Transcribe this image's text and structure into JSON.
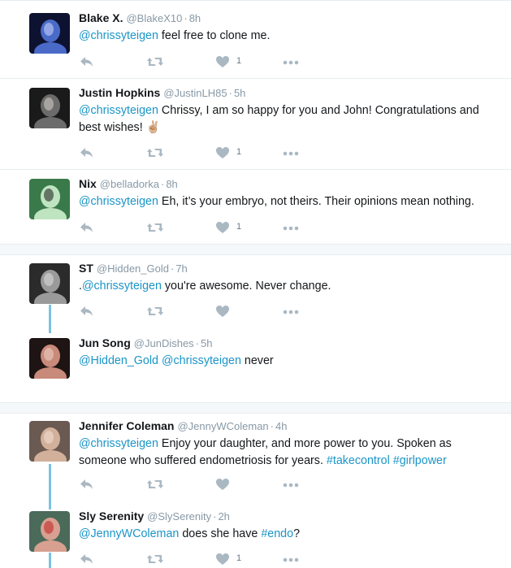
{
  "tweets": [
    {
      "name": "Blake X.",
      "handle": "@BlakeX10",
      "time": "8h",
      "segments": [
        {
          "t": "@chrissyteigen",
          "k": "m"
        },
        {
          "t": " feel free to clone me.",
          "k": "t"
        }
      ],
      "likes": "1"
    },
    {
      "name": "Justin Hopkins",
      "handle": "@JustinLH85",
      "time": "5h",
      "segments": [
        {
          "t": "@chrissyteigen",
          "k": "m"
        },
        {
          "t": " Chrissy, I am so happy for you and John! Congratulations and best wishes! ✌🏼 ",
          "k": "t"
        }
      ],
      "likes": "1"
    },
    {
      "name": "Nix",
      "handle": "@belladorka",
      "time": "8h",
      "segments": [
        {
          "t": "@chrissyteigen",
          "k": "m"
        },
        {
          "t": " Eh, it’s your embryo, not theirs. Their opinions mean nothing.",
          "k": "t"
        }
      ],
      "likes": "1"
    },
    {
      "name": "ST",
      "handle": "@Hidden_Gold",
      "time": "7h",
      "segments": [
        {
          "t": ".",
          "k": "t"
        },
        {
          "t": "@chrissyteigen",
          "k": "m"
        },
        {
          "t": " you're awesome. Never change.",
          "k": "t"
        }
      ],
      "likes": ""
    },
    {
      "name": "Jun Song",
      "handle": "@JunDishes",
      "time": "5h",
      "segments": [
        {
          "t": "@Hidden_Gold",
          "k": "m"
        },
        {
          "t": " ",
          "k": "t"
        },
        {
          "t": "@chrissyteigen",
          "k": "m"
        },
        {
          "t": " never",
          "k": "t"
        }
      ],
      "likes": null
    },
    {
      "name": "Jennifer Coleman",
      "handle": "@JennyWColeman",
      "time": "4h",
      "segments": [
        {
          "t": "@chrissyteigen",
          "k": "m"
        },
        {
          "t": " Enjoy your daughter, and more power to you. Spoken as someone who suffered endometriosis for years. ",
          "k": "t"
        },
        {
          "t": "#takecontrol",
          "k": "h"
        },
        {
          "t": " ",
          "k": "t"
        },
        {
          "t": "#girlpower",
          "k": "h"
        }
      ],
      "likes": ""
    },
    {
      "name": "Sly Serenity",
      "handle": "@SlySerenity",
      "time": "2h",
      "segments": [
        {
          "t": "@JennyWColeman",
          "k": "m"
        },
        {
          "t": " does she have ",
          "k": "t"
        },
        {
          "t": "#endo",
          "k": "h"
        },
        {
          "t": "?",
          "k": "t"
        }
      ],
      "likes": "1"
    }
  ],
  "icons": {
    "reply": "reply-icon",
    "retweet": "retweet-icon",
    "like": "heart-icon",
    "more": "more-icon"
  },
  "colors": {
    "link": "#1b95c7",
    "icon": "#aab8c2",
    "thread_line": "#7cc2e0",
    "separator": "#e6ecf0",
    "gap": "#f5f8fa"
  }
}
